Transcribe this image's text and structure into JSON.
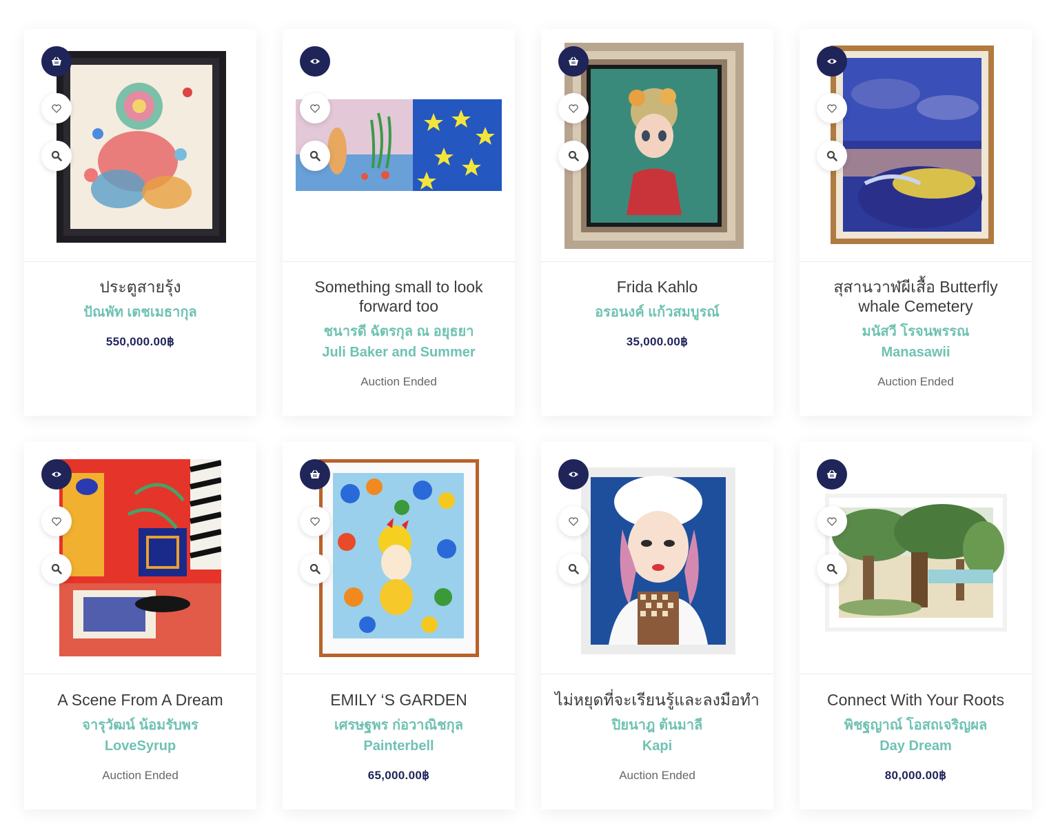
{
  "products": [
    {
      "title": "ประตูสายรุ้ง",
      "artists": [
        "ปัณพัท เตชเมธากุล"
      ],
      "price": "550,000.00฿",
      "primary_icon": "basket-icon"
    },
    {
      "title": "Something small to look forward too",
      "artists": [
        "ชนารดี ฉัตรกุล ณ อยุธยา",
        "Juli Baker and Summer"
      ],
      "status": "Auction Ended",
      "primary_icon": "eye-icon"
    },
    {
      "title": "Frida Kahlo",
      "artists": [
        "อรอนงค์ แก้วสมบูรณ์"
      ],
      "price": "35,000.00฿",
      "primary_icon": "basket-icon"
    },
    {
      "title": "สุสานวาฬผีเสื้อ Butterfly whale Cemetery",
      "artists": [
        "มนัสวี โรจนพรรณ",
        "Manasawii"
      ],
      "status": "Auction Ended",
      "primary_icon": "eye-icon"
    },
    {
      "title": "A Scene From A Dream",
      "artists": [
        "จารุวัฒน์ น้อมรับพร",
        "LoveSyrup"
      ],
      "status": "Auction Ended",
      "primary_icon": "eye-icon"
    },
    {
      "title": "EMILY ‘S GARDEN",
      "artists": [
        "เศรษฐพร ก่อวาณิชกุล",
        "Painterbell"
      ],
      "price": "65,000.00฿",
      "primary_icon": "basket-icon"
    },
    {
      "title": "ไม่หยุดที่จะเรียนรู้และลงมือทำ",
      "artists": [
        "ปิยนาฎ ต้นมาลี",
        "Kapi"
      ],
      "status": "Auction Ended",
      "primary_icon": "eye-icon"
    },
    {
      "title": "Connect With Your Roots",
      "artists": [
        "พิชฐญาณ์ โอสถเจริญผล",
        "Day Dream"
      ],
      "price": "80,000.00฿",
      "primary_icon": "basket-icon"
    }
  ],
  "colors": {
    "primary": "#1f2459",
    "artist_text": "#6fc2b2",
    "title_text": "#3b3b3b",
    "status_text": "#666666"
  }
}
